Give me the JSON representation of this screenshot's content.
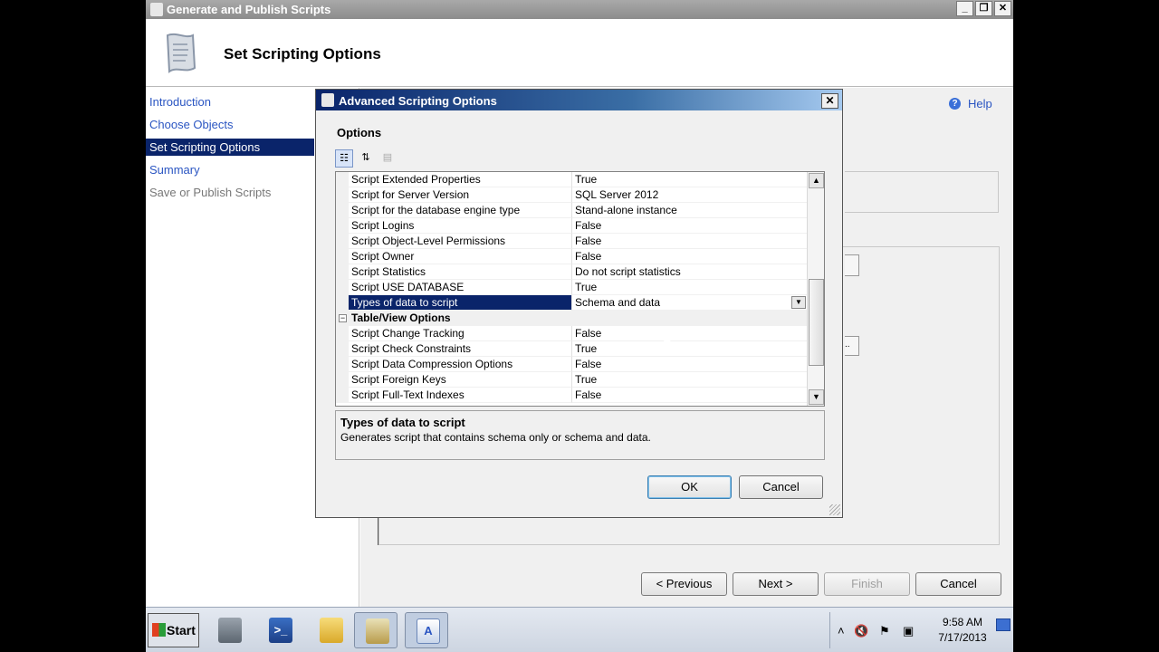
{
  "window": {
    "title": "Generate and Publish Scripts",
    "buttons": [
      "_",
      "❐",
      "✕"
    ]
  },
  "header": {
    "title": "Set Scripting Options",
    "icon": "scroll-icon"
  },
  "nav": {
    "items": [
      {
        "label": "Introduction",
        "state": "link"
      },
      {
        "label": "Choose Objects",
        "state": "link"
      },
      {
        "label": "Set Scripting Options",
        "state": "active"
      },
      {
        "label": "Summary",
        "state": "link"
      },
      {
        "label": "Save or Publish Scripts",
        "state": "disabled"
      }
    ]
  },
  "help": {
    "label": "Help"
  },
  "wizard_buttons": {
    "previous": "< Previous",
    "next": "Next >",
    "finish": "Finish",
    "cancel": "Cancel"
  },
  "dialog": {
    "title": "Advanced Scripting Options",
    "close": "✕",
    "options_label": "Options",
    "rows": [
      {
        "name": "Script Extended Properties",
        "value": "True"
      },
      {
        "name": "Script for Server Version",
        "value": "SQL Server 2012"
      },
      {
        "name": "Script for the database engine type",
        "value": "Stand-alone instance"
      },
      {
        "name": "Script Logins",
        "value": "False"
      },
      {
        "name": "Script Object-Level Permissions",
        "value": "False"
      },
      {
        "name": "Script Owner",
        "value": "False"
      },
      {
        "name": "Script Statistics",
        "value": "Do not script statistics"
      },
      {
        "name": "Script USE DATABASE",
        "value": "True"
      },
      {
        "name": "Types of data to script",
        "value": "Schema and data",
        "selected": true
      },
      {
        "category": "Table/View Options"
      },
      {
        "name": "Script Change Tracking",
        "value": "False"
      },
      {
        "name": "Script Check Constraints",
        "value": "True"
      },
      {
        "name": "Script Data Compression Options",
        "value": "False"
      },
      {
        "name": "Script Foreign Keys",
        "value": "True"
      },
      {
        "name": "Script Full-Text Indexes",
        "value": "False"
      }
    ],
    "description": {
      "heading": "Types of data to script",
      "body": "Generates script that contains schema only or schema and data."
    },
    "ok": "OK",
    "cancel": "Cancel"
  },
  "taskbar": {
    "start": "Start",
    "apps": [
      "server-manager-icon",
      "powershell-icon",
      "explorer-folder-icon",
      "ssms-tools-icon",
      "wordpad-icon"
    ],
    "clock": {
      "time": "9:58 AM",
      "date": "7/17/2013"
    }
  },
  "colors": {
    "selection": "#0a246a",
    "link": "#2a55c2",
    "dialog_title_start": "#0a246a",
    "dialog_title_end": "#a6caf0"
  }
}
